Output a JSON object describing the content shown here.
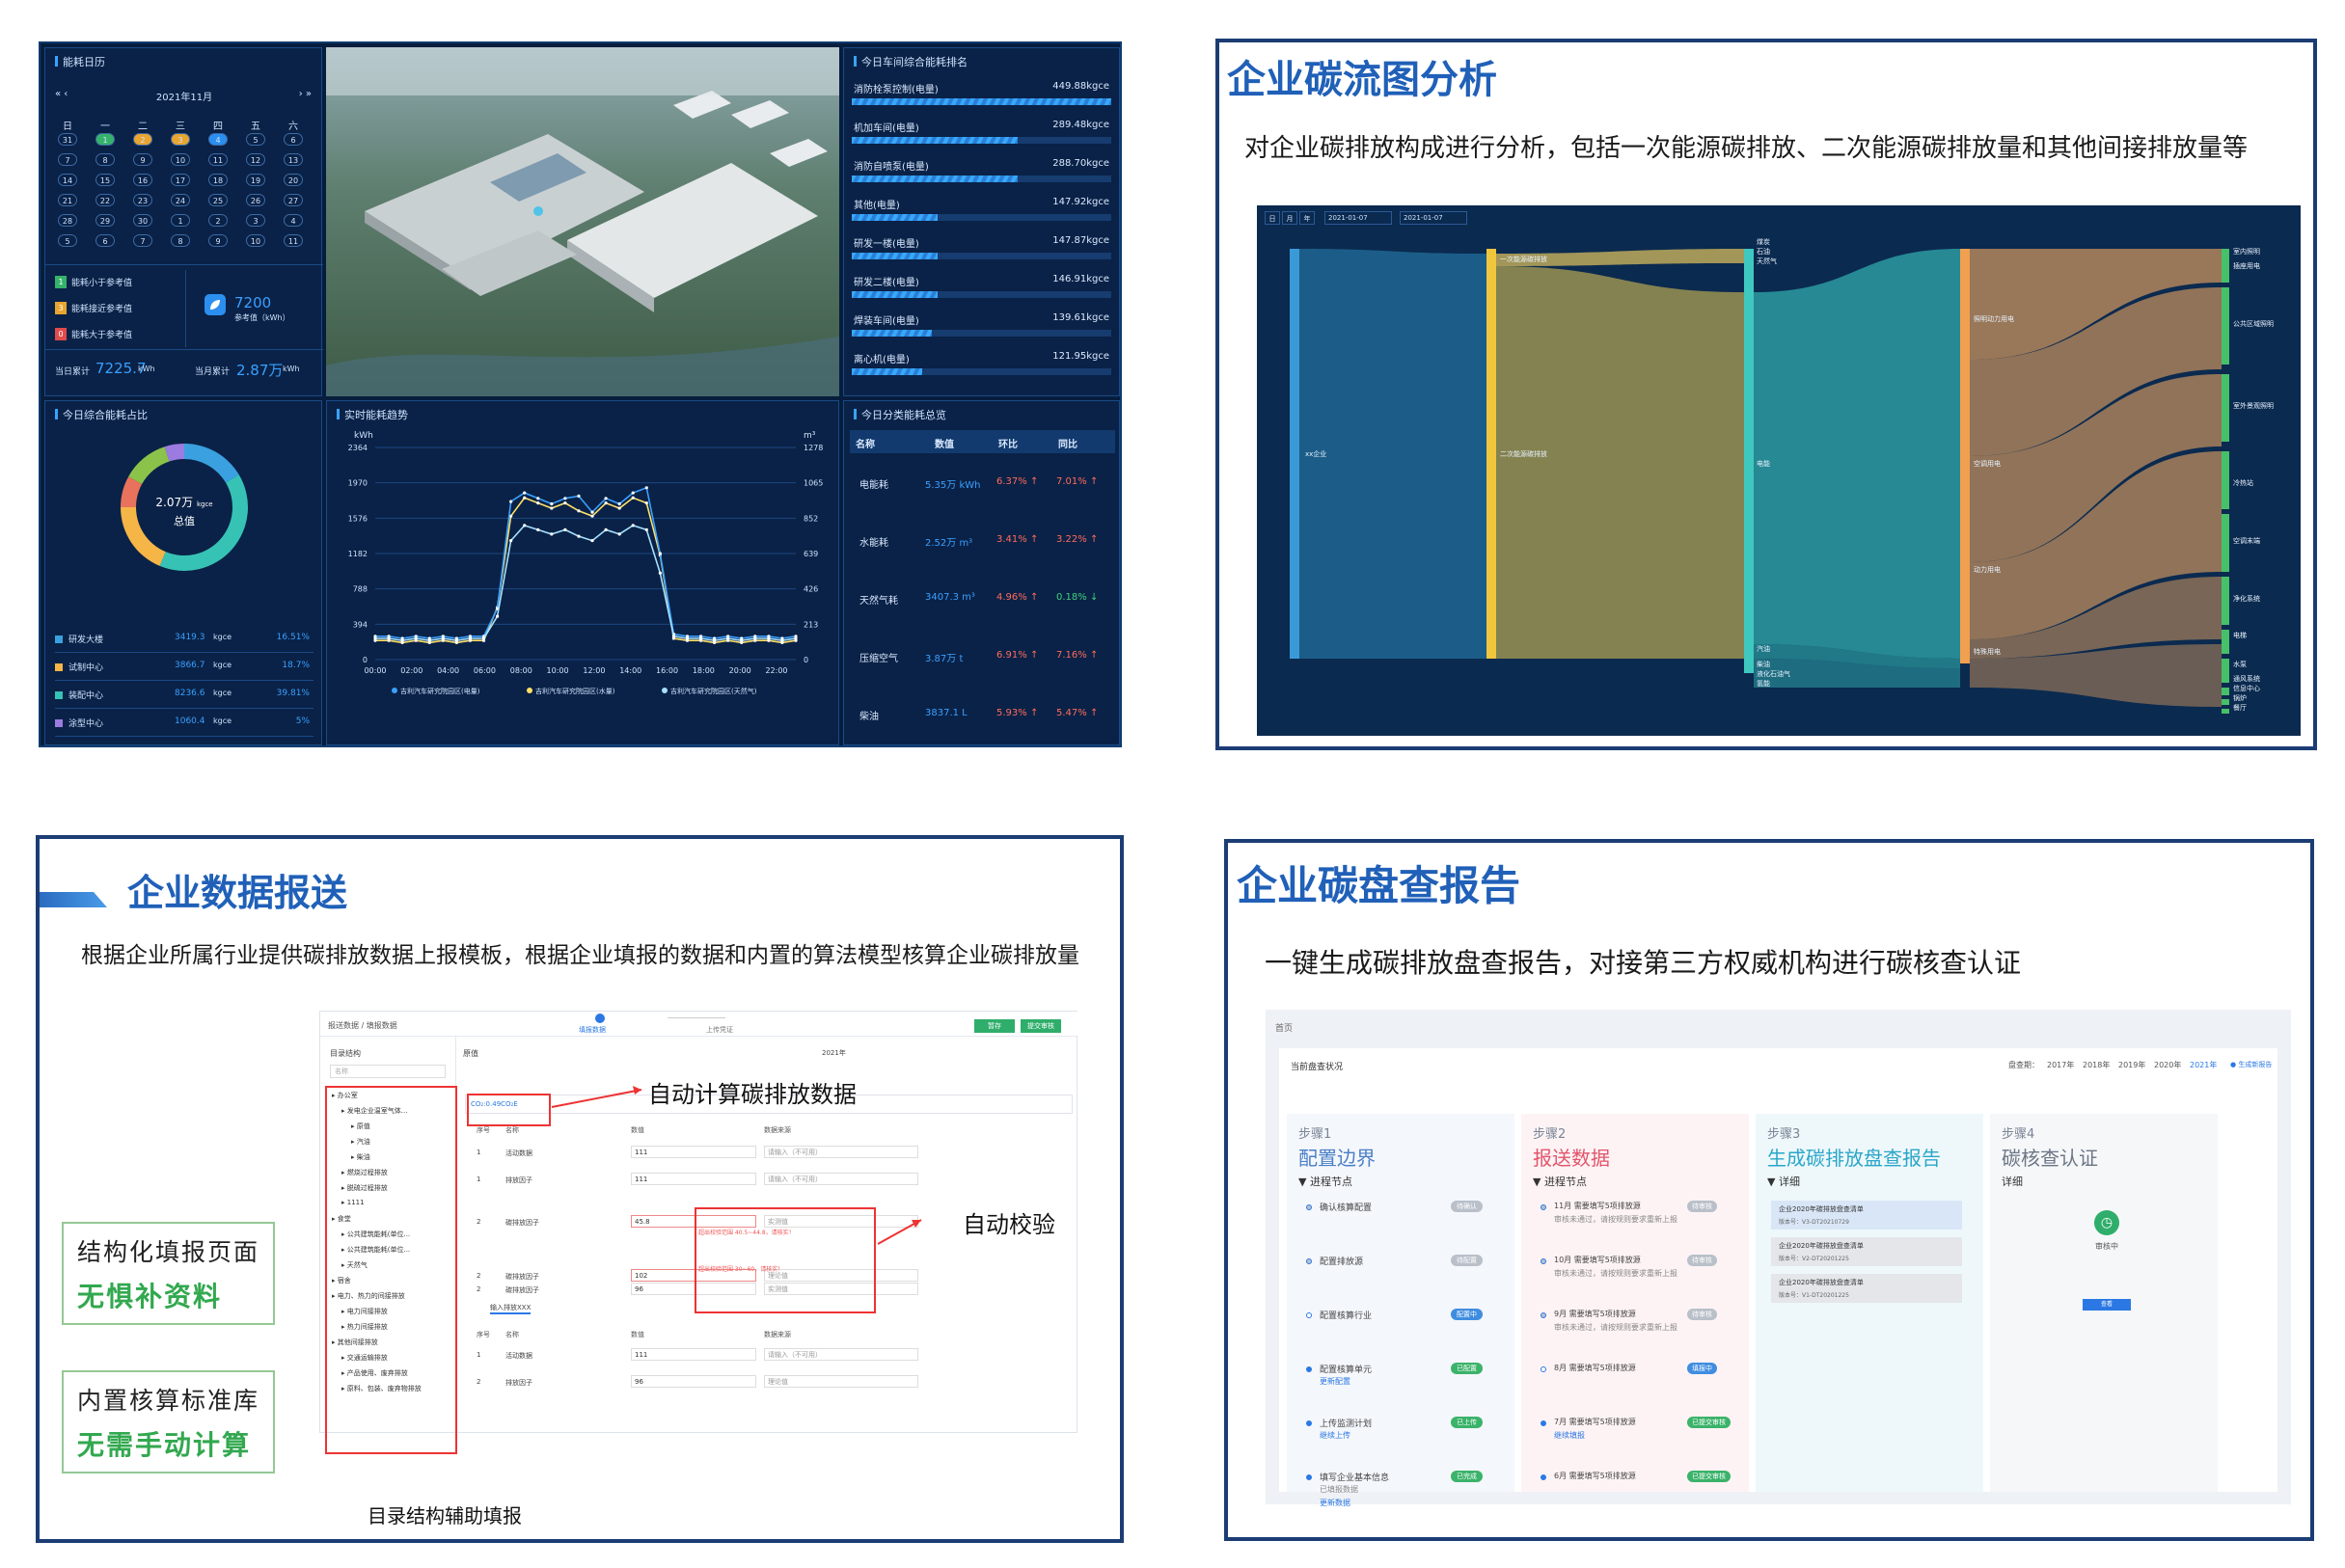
{
  "q1": {
    "calendar": {
      "title": "能耗日历",
      "month": "2021年11月",
      "nav_prev": "« ‹",
      "nav_next": "› »",
      "weekdays": [
        "日",
        "一",
        "二",
        "三",
        "四",
        "五",
        "六"
      ],
      "days": [
        "31",
        "1",
        "2",
        "3",
        "4",
        "5",
        "6",
        "7",
        "8",
        "9",
        "10",
        "11",
        "12",
        "13",
        "14",
        "15",
        "16",
        "17",
        "18",
        "19",
        "20",
        "21",
        "22",
        "23",
        "24",
        "25",
        "26",
        "27",
        "28",
        "29",
        "30",
        "1",
        "2",
        "3",
        "4",
        "5",
        "6",
        "7",
        "8",
        "9",
        "10",
        "11"
      ],
      "legend": [
        {
          "badge": "1",
          "label": "能耗小于参考值",
          "color": "#36b36a"
        },
        {
          "badge": "3",
          "label": "能耗接近参考值",
          "color": "#e8a530"
        },
        {
          "badge": "0",
          "label": "能耗大于参考值",
          "color": "#e04b4b"
        }
      ],
      "ref_value": "7200",
      "ref_label": "参考值（kWh）",
      "day_total_label": "当日累计",
      "day_total_value": "7225.7",
      "day_total_unit": "kWh",
      "month_total_label": "当月累计",
      "month_total_value": "2.87万",
      "month_total_unit": "kWh"
    },
    "ranking": {
      "title": "今日车间综合能耗排名",
      "items": [
        {
          "name": "消防栓泵控制(电量)",
          "value": "449.88kgce",
          "pct": 1.0
        },
        {
          "name": "机加车间(电量)",
          "value": "289.48kgce",
          "pct": 0.64
        },
        {
          "name": "消防自喷泵(电量)",
          "value": "288.70kgce",
          "pct": 0.64
        },
        {
          "name": "其他(电量)",
          "value": "147.92kgce",
          "pct": 0.33
        },
        {
          "name": "研发一楼(电量)",
          "value": "147.87kgce",
          "pct": 0.33
        },
        {
          "name": "研发二楼(电量)",
          "value": "146.91kgce",
          "pct": 0.33
        },
        {
          "name": "焊装车间(电量)",
          "value": "139.61kgce",
          "pct": 0.31
        },
        {
          "name": "离心机(电量)",
          "value": "121.95kgce",
          "pct": 0.27
        }
      ]
    },
    "donut": {
      "title": "今日综合能耗占比",
      "center_value": "2.07万",
      "center_unit": "kgce",
      "center_label": "总值",
      "items": [
        {
          "name": "研发大楼",
          "value": "3419.3",
          "unit": "kgce",
          "pct": "16.51%",
          "color": "#3aa0e0"
        },
        {
          "name": "试制中心",
          "value": "3866.7",
          "unit": "kgce",
          "pct": "18.7%",
          "color": "#f5b547"
        },
        {
          "name": "装配中心",
          "value": "8236.6",
          "unit": "kgce",
          "pct": "39.81%",
          "color": "#36c3b5"
        },
        {
          "name": "涂型中心",
          "value": "1060.4",
          "unit": "kgce",
          "pct": "5%",
          "color": "#9b7be0"
        }
      ]
    },
    "trend": {
      "title": "实时能耗趋势",
      "left_unit": "kWh",
      "right_unit": "m³",
      "left_ticks": [
        "2364",
        "1970",
        "1576",
        "1182",
        "788",
        "394",
        "0"
      ],
      "right_ticks": [
        "1278",
        "1065",
        "852",
        "639",
        "426",
        "213",
        "0"
      ],
      "x_ticks": [
        "00:00",
        "02:00",
        "04:00",
        "06:00",
        "08:00",
        "10:00",
        "12:00",
        "14:00",
        "16:00",
        "18:00",
        "20:00",
        "22:00"
      ],
      "legend": [
        "吉利汽车研究院园区(电量)",
        "吉利汽车研究院园区(水量)",
        "吉利汽车研究院园区(天然气)"
      ]
    },
    "category": {
      "title": "今日分类能耗总览",
      "headers": [
        "名称",
        "数值",
        "环比",
        "同比"
      ],
      "rows": [
        {
          "name": "电能耗",
          "value": "5.35万 kWh",
          "mom": "6.37%",
          "yoy": "7.01%",
          "yoy_dir": "up"
        },
        {
          "name": "水能耗",
          "value": "2.52万 m³",
          "mom": "3.41%",
          "yoy": "3.22%",
          "yoy_dir": "up"
        },
        {
          "name": "天然气耗",
          "value": "3407.3 m³",
          "mom": "4.96%",
          "yoy": "0.18%",
          "yoy_dir": "down"
        },
        {
          "name": "压缩空气",
          "value": "3.87万 t",
          "mom": "6.91%",
          "yoy": "7.16%",
          "yoy_dir": "up"
        },
        {
          "name": "柴油",
          "value": "3837.1 L",
          "mom": "5.93%",
          "yoy": "5.47%",
          "yoy_dir": "up"
        }
      ]
    }
  },
  "q2": {
    "title": "企业碳流图分析",
    "subtitle": "对企业碳排放构成进行分析，包括一次能源碳排放、二次能源碳排放量和其他间接排放量等",
    "toolbar": {
      "tabs": [
        "日",
        "月",
        "年"
      ],
      "date_from": "2021-01-07",
      "date_to": "2021-01-07"
    },
    "nodes": {
      "root": "xx企业",
      "first": "一次能源碳排放",
      "second": "二次能源碳排放",
      "fuels": [
        "煤炭",
        "石油",
        "天然气"
      ],
      "mid": [
        "电能",
        "汽油",
        "柴油",
        "液化石油气",
        "氢能"
      ],
      "usage": [
        "照明动力用电",
        "空调用电",
        "动力用电",
        "特殊用电"
      ],
      "sinks": [
        "室内照明",
        "插座用电",
        "公共区域照明",
        "室外景观照明",
        "冷热站",
        "空调末端",
        "净化系统",
        "电梯",
        "水泵",
        "通风系统",
        "信息中心",
        "锅炉",
        "餐厅"
      ]
    }
  },
  "q3": {
    "title": "企业数据报送",
    "subtitle": "根据企业所属行业提供碳排放数据上报模板，根据企业填报的数据和内置的算法模型核算企业碳排放量",
    "box1": {
      "line1": "结构化填报页面",
      "line2": "无惧补资料"
    },
    "box2": {
      "line1": "内置核算标准库",
      "line2": "无需手动计算"
    },
    "callout_calc": "自动计算碳排放数据",
    "callout_check": "自动校验",
    "callout_tree": "目录结构辅助填报",
    "ss": {
      "breadcrumb": "报送数据 / 填报数据",
      "step1": "填报数据",
      "step2": "上传凭证",
      "btn1": "暂存",
      "btn2": "提交审核",
      "tree_title": "目录结构",
      "tree_search": "名称",
      "tree": [
        "办公室",
        "发电企业温室气体...",
        "原值",
        "汽油",
        "柴油",
        "燃烧过程排放",
        "脱硫过程排放",
        "1111",
        "食堂",
        "公共建筑能耗(单位...",
        "公共建筑能耗(单位...",
        "天然气",
        "宿舍",
        "电力、热力的间接排放",
        "电力间接排放",
        "热力间接排放",
        "其他间接排放",
        "交通运输排放",
        "产品使用、废弃排放",
        "原料、包装、废弃物排放"
      ],
      "crumb2": "原值",
      "year_label": "2021年",
      "co2": "CO₂:0.49CO₂E",
      "th": [
        "序号",
        "名称",
        "数值",
        "数据来源"
      ],
      "rows": [
        {
          "n": "1",
          "name": "活动数据",
          "val": "111",
          "src": "请输入（不可用）"
        },
        {
          "n": "1",
          "name": "排放因子",
          "val": "111",
          "src": "请输入（不可用）"
        },
        {
          "n": "2",
          "name": "碳排放因子",
          "val": "45.8",
          "src": "实测值"
        },
        {
          "n": "2",
          "name": "碳排放因子",
          "val": "102",
          "src": "理论值"
        },
        {
          "n": "2",
          "name": "碳排放因子",
          "val": "96",
          "src": "实测值"
        }
      ],
      "warn1": "超出校验范围 40.5~44.8，请核实！",
      "warn2": "超出校验范围 30~60，请核实！",
      "section2": "输入排放XXX",
      "rows2": [
        {
          "n": "1",
          "name": "活动数据",
          "val": "111",
          "src": "请输入（不可用）"
        },
        {
          "n": "2",
          "name": "排放因子",
          "val": "96",
          "src": "理论值"
        }
      ]
    }
  },
  "q4": {
    "title": "企业碳盘查报告",
    "subtitle": "一键生成碳排放盘查报告，对接第三方权威机构进行碳核查认证",
    "ss": {
      "home": "首页",
      "panel_title": "当前盘查状况",
      "year_label": "盘查期：",
      "years": [
        "2017年",
        "2018年",
        "2019年",
        "2020年",
        "2021年"
      ],
      "new_btn": "生成新报告",
      "steps": [
        {
          "label": "步骤1",
          "title": "配置边界",
          "color": "#4a7fc8",
          "sub": "进程节点"
        },
        {
          "label": "步骤2",
          "title": "报送数据",
          "color": "#e2556b",
          "sub": "进程节点"
        },
        {
          "label": "步骤3",
          "title": "生成碳排放盘查报告",
          "color": "#2aa6c8",
          "sub": "详细"
        },
        {
          "label": "步骤4",
          "title": "碳核查认证",
          "color": "#6b7686",
          "sub": "详细"
        }
      ],
      "step1_items": [
        {
          "t": "确认核算配置",
          "chip": "待确认",
          "c": "#b9c0c9"
        },
        {
          "t": "配置排放源",
          "chip": "待配置",
          "c": "#b9c0c9"
        },
        {
          "t": "配置核算行业",
          "chip": "配置中",
          "c": "#3f8de0"
        },
        {
          "t": "配置核算单元",
          "l": "更新配置",
          "chip": "已配置",
          "c": "#3bb36a"
        },
        {
          "t": "上传监测计划",
          "l": "继续上传",
          "chip": "已上传",
          "c": "#3bb36a"
        },
        {
          "t": "填写企业基本信息",
          "l2": "已填报数据",
          "l": "更新数据",
          "chip": "已完成",
          "c": "#3bb36a"
        }
      ],
      "step2_items": [
        {
          "t": "11月 需要填写5项排放源",
          "d": "审核未通过，请按规则要求重新上报",
          "chip": "待审核",
          "c": "#b9c0c9"
        },
        {
          "t": "10月 需要填写5项排放源",
          "d": "审核未通过，请按规则要求重新上报",
          "chip": "待审核",
          "c": "#b9c0c9"
        },
        {
          "t": "9月 需要填写5项排放源",
          "d": "审核未通过，请按规则要求重新上报",
          "chip": "待审核",
          "c": "#b9c0c9"
        },
        {
          "t": "8月 需要填写5项排放源",
          "chip": "填报中",
          "c": "#3f8de0"
        },
        {
          "t": "7月 需要填写5项排放源",
          "l": "继续填报",
          "chip": "已提交审核",
          "c": "#3bb36a"
        },
        {
          "t": "6月 需要填写5项排放源",
          "chip": "已提交审核",
          "c": "#3bb36a"
        }
      ],
      "reports": [
        {
          "t": "企业2020年碳排放盘查清单",
          "v": "版本号：V3-DT20210729"
        },
        {
          "t": "企业2020年碳排放盘查清单",
          "v": "版本号：V2-DT20201225"
        },
        {
          "t": "企业2020年碳排放盘查清单",
          "v": "版本号：V1-DT20201225"
        }
      ],
      "verify_status": "审核中",
      "verify_btn": "查看"
    }
  }
}
